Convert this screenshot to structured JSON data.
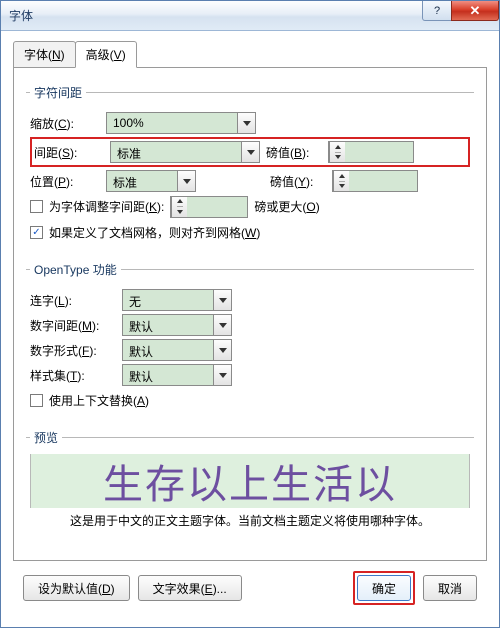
{
  "window": {
    "title": "字体"
  },
  "tabs": {
    "font": {
      "label": "字体(",
      "key": "N",
      "after": ")"
    },
    "advanced": {
      "label": "高级(",
      "key": "V",
      "after": ")"
    }
  },
  "char_spacing": {
    "legend": "字符间距",
    "scale_label": "缩放(",
    "scale_key": "C",
    "scale_after": "):",
    "scale_value": "100%",
    "spacing_label": "间距(",
    "spacing_key": "S",
    "spacing_after": "):",
    "spacing_value": "标准",
    "pt_label": "磅值(",
    "pt_key": "B",
    "pt_after": "):",
    "pt_value": "",
    "position_label": "位置(",
    "position_key": "P",
    "position_after": "):",
    "position_value": "标准",
    "pt2_label": "磅值(",
    "pt2_key": "Y",
    "pt2_after": "):",
    "pt2_value": "",
    "kerning_label_pre": "为字体调整字间距(",
    "kerning_key": "K",
    "kerning_after": "):",
    "kerning_value": "",
    "kerning_unit_pre": "磅或更大(",
    "kerning_unit_key": "O",
    "kerning_unit_after": ")",
    "grid_label_pre": "如果定义了文档网格，则对齐到网格(",
    "grid_key": "W",
    "grid_after": ")"
  },
  "opentype": {
    "legend": "OpenType 功能",
    "liga_label": "连字(",
    "liga_key": "L",
    "liga_after": "):",
    "liga_value": "无",
    "numspacing_label": "数字间距(",
    "numspacing_key": "M",
    "numspacing_after": "):",
    "numspacing_value": "默认",
    "numform_label": "数字形式(",
    "numform_key": "F",
    "numform_after": "):",
    "numform_value": "默认",
    "styleset_label": "样式集(",
    "styleset_key": "T",
    "styleset_after": "):",
    "styleset_value": "默认",
    "contextual_pre": "使用上下文替换(",
    "contextual_key": "A",
    "contextual_after": ")"
  },
  "preview": {
    "legend": "预览",
    "sample": "生存以上生活以",
    "desc": "这是用于中文的正文主题字体。当前文档主题定义将使用哪种字体。"
  },
  "footer": {
    "default_pre": "设为默认值(",
    "default_key": "D",
    "default_after": ")",
    "effects_pre": "文字效果(",
    "effects_key": "E",
    "effects_after": ")...",
    "ok": "确定",
    "cancel": "取消"
  }
}
